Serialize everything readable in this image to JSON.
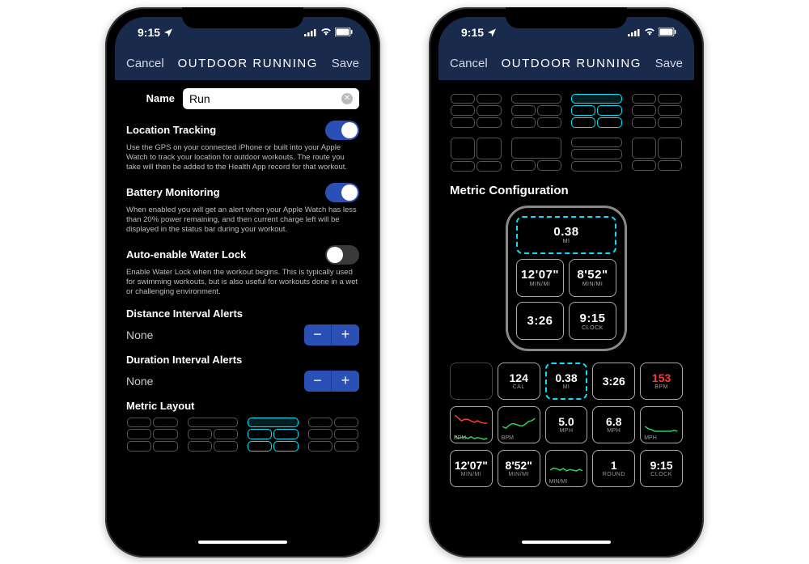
{
  "status": {
    "time": "9:15",
    "signal": 4
  },
  "nav": {
    "cancel": "Cancel",
    "title": "OUTDOOR RUNNING",
    "save": "Save"
  },
  "name": {
    "label": "Name",
    "value": "Run"
  },
  "settings": {
    "location": {
      "title": "Location Tracking",
      "desc": "Use the GPS on your connected iPhone or built into your Apple Watch to track your location for outdoor workouts. The route you take will then be added to the Health App record for that workout.",
      "on": true
    },
    "battery": {
      "title": "Battery Monitoring",
      "desc": "When enabled you will get an alert when your Apple Watch has less than 20% power remaining, and then current charge left will be displayed in the status bar during your workout.",
      "on": true
    },
    "waterlock": {
      "title": "Auto-enable Water Lock",
      "desc": "Enable Water Lock when the workout begins. This is typically used for swimming workouts, but is also useful for workouts done in a wet or challenging environment.",
      "on": false
    }
  },
  "intervals": {
    "distance": {
      "title": "Distance Interval Alerts",
      "value": "None"
    },
    "duration": {
      "title": "Duration Interval Alerts",
      "value": "None"
    }
  },
  "metric_layout_title": "Metric Layout",
  "metric_config_title": "Metric Configuration",
  "watch": {
    "top": {
      "v": "0.38",
      "u": "MI"
    },
    "a": {
      "v": "12'07\"",
      "u": "MIN/MI"
    },
    "b": {
      "v": "8'52\"",
      "u": "MIN/MI"
    },
    "c": {
      "v": "3:26",
      "u": ""
    },
    "d": {
      "v": "9:15",
      "u": "CLOCK"
    }
  },
  "row1": [
    {
      "v": "",
      "u": "",
      "cls": "empty"
    },
    {
      "v": "124",
      "u": "CAL"
    },
    {
      "v": "0.38",
      "u": "MI",
      "cls": "dash"
    },
    {
      "v": "3:26",
      "u": ""
    },
    {
      "v": "153",
      "u": "BPM",
      "cls": "red"
    }
  ],
  "row2": [
    {
      "spark": "rg",
      "u": "BPM"
    },
    {
      "spark": "g",
      "u": "BPM"
    },
    {
      "v": "5.0",
      "u": "MPH"
    },
    {
      "v": "6.8",
      "u": "MPH"
    },
    {
      "spark": "g",
      "u": "MPH"
    }
  ],
  "row3": [
    {
      "v": "12'07\"",
      "u": "MIN/MI"
    },
    {
      "v": "8'52\"",
      "u": "MIN/MI"
    },
    {
      "spark": "g",
      "u": "MIN/MI"
    },
    {
      "v": "1",
      "u": "ROUND"
    },
    {
      "v": "9:15",
      "u": "CLOCK"
    }
  ]
}
